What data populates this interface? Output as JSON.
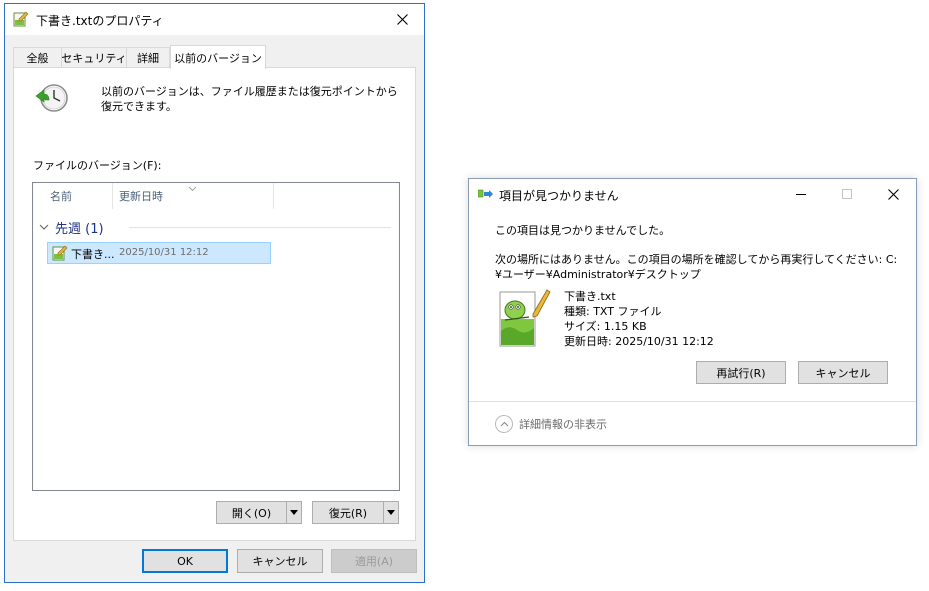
{
  "properties_dialog": {
    "title": "下書き.txtのプロパティ",
    "tabs": [
      {
        "label": "全般"
      },
      {
        "label": "セキュリティ"
      },
      {
        "label": "詳細"
      },
      {
        "label": "以前のバージョン",
        "active": true
      }
    ],
    "description": "以前のバージョンは、ファイル履歴または復元ポイントから復元できます。",
    "versions_label": "ファイルのバージョン(F):",
    "columns": [
      "名前",
      "更新日時"
    ],
    "group": {
      "label": "先週 (1)"
    },
    "file_row": {
      "name": "下書き...",
      "date": "2025/10/31 12:12"
    },
    "open_button": "開く(O)",
    "restore_button": "復元(R)",
    "ok_button": "OK",
    "cancel_button": "キャンセル",
    "apply_button": "適用(A)"
  },
  "not_found_dialog": {
    "title": "項目が見つかりません",
    "message1": "この項目は見つかりませんでした。",
    "message2": "次の場所にはありません。この項目の場所を確認してから再実行してください: C:¥ユーザー¥Administrator¥デスクトップ",
    "file": {
      "name": "下書き.txt",
      "type": "種類: TXT ファイル",
      "size": "サイズ: 1.15 KB",
      "modified": "更新日時: 2025/10/31 12:12"
    },
    "retry_button": "再試行(R)",
    "cancel_button": "キャンセル",
    "details_toggle": "詳細情報の非表示"
  },
  "colors": {
    "accent": "#0078d7",
    "selection": "#cce8ff",
    "group_text": "#1e3287"
  }
}
